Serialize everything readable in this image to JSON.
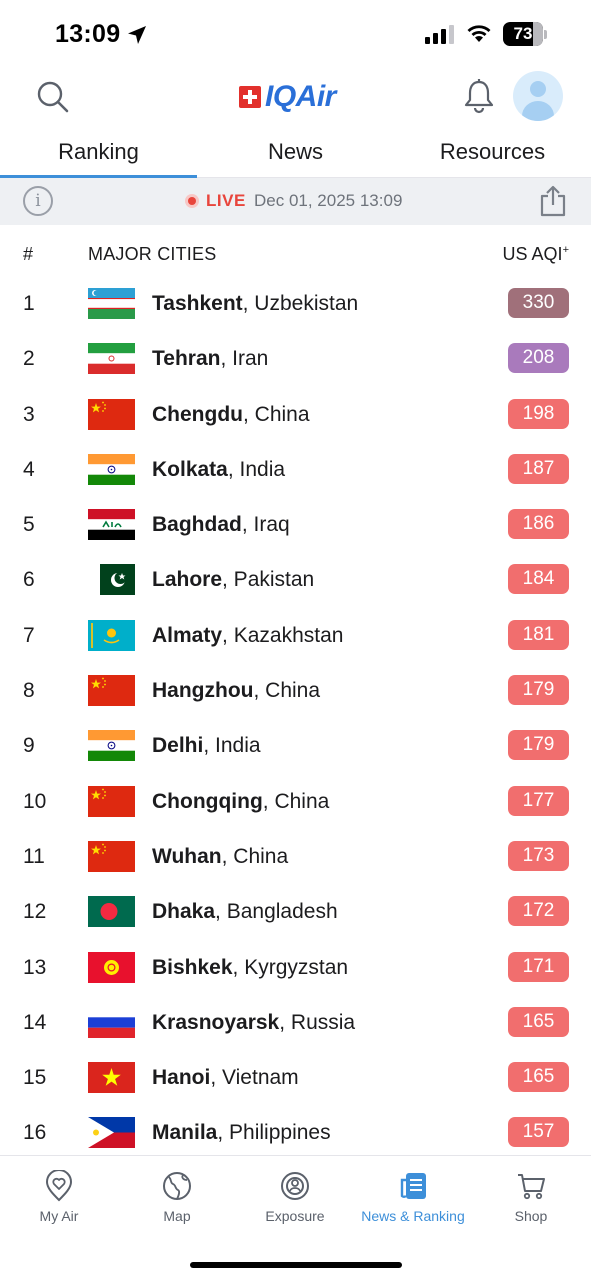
{
  "status_bar": {
    "time": "13:09",
    "battery": "73"
  },
  "header": {
    "logo_text": "IQAir"
  },
  "tabs": [
    {
      "label": "Ranking",
      "active": true
    },
    {
      "label": "News",
      "active": false
    },
    {
      "label": "Resources",
      "active": false
    }
  ],
  "live": {
    "label": "LIVE",
    "datetime": "Dec 01, 2025 13:09"
  },
  "table": {
    "col_rank": "#",
    "col_cities": "MAJOR CITIES",
    "col_aqi": "US AQI",
    "col_aqi_sup": "+"
  },
  "rankings": [
    {
      "rank": "1",
      "city": "Tashkent",
      "country": ", Uzbekistan",
      "aqi": "330",
      "color": "#a0707a",
      "flag": "uz"
    },
    {
      "rank": "2",
      "city": "Tehran",
      "country": ", Iran",
      "aqi": "208",
      "color": "#a97abc",
      "flag": "ir"
    },
    {
      "rank": "3",
      "city": "Chengdu",
      "country": ", China",
      "aqi": "198",
      "color": "#f16e6e",
      "flag": "cn"
    },
    {
      "rank": "4",
      "city": "Kolkata",
      "country": ", India",
      "aqi": "187",
      "color": "#f16e6e",
      "flag": "in"
    },
    {
      "rank": "5",
      "city": "Baghdad",
      "country": ", Iraq",
      "aqi": "186",
      "color": "#f16e6e",
      "flag": "iq"
    },
    {
      "rank": "6",
      "city": "Lahore",
      "country": ", Pakistan",
      "aqi": "184",
      "color": "#f16e6e",
      "flag": "pk"
    },
    {
      "rank": "7",
      "city": "Almaty",
      "country": ", Kazakhstan",
      "aqi": "181",
      "color": "#f16e6e",
      "flag": "kz"
    },
    {
      "rank": "8",
      "city": "Hangzhou",
      "country": ", China",
      "aqi": "179",
      "color": "#f16e6e",
      "flag": "cn"
    },
    {
      "rank": "9",
      "city": "Delhi",
      "country": ", India",
      "aqi": "179",
      "color": "#f16e6e",
      "flag": "in"
    },
    {
      "rank": "10",
      "city": "Chongqing",
      "country": ", China",
      "aqi": "177",
      "color": "#f16e6e",
      "flag": "cn"
    },
    {
      "rank": "11",
      "city": "Wuhan",
      "country": ", China",
      "aqi": "173",
      "color": "#f16e6e",
      "flag": "cn"
    },
    {
      "rank": "12",
      "city": "Dhaka",
      "country": ", Bangladesh",
      "aqi": "172",
      "color": "#f16e6e",
      "flag": "bd"
    },
    {
      "rank": "13",
      "city": "Bishkek",
      "country": ", Kyrgyzstan",
      "aqi": "171",
      "color": "#f16e6e",
      "flag": "kg"
    },
    {
      "rank": "14",
      "city": "Krasnoyarsk",
      "country": ", Russia",
      "aqi": "165",
      "color": "#f16e6e",
      "flag": "ru"
    },
    {
      "rank": "15",
      "city": "Hanoi",
      "country": ", Vietnam",
      "aqi": "165",
      "color": "#f16e6e",
      "flag": "vn"
    },
    {
      "rank": "16",
      "city": "Manila",
      "country": ", Philippines",
      "aqi": "157",
      "color": "#f16e6e",
      "flag": "ph"
    }
  ],
  "bottom_nav": [
    {
      "label": "My Air",
      "icon": "heart-pin-icon",
      "active": false
    },
    {
      "label": "Map",
      "icon": "globe-icon",
      "active": false
    },
    {
      "label": "Exposure",
      "icon": "exposure-icon",
      "active": false
    },
    {
      "label": "News & Ranking",
      "icon": "news-icon",
      "active": true
    },
    {
      "label": "Shop",
      "icon": "cart-icon",
      "active": false
    }
  ],
  "colors": {
    "accent": "#3d8fd9",
    "live_red": "#e8453c",
    "aqi_red": "#f16e6e",
    "aqi_purple": "#a97abc",
    "aqi_maroon": "#a0707a"
  }
}
